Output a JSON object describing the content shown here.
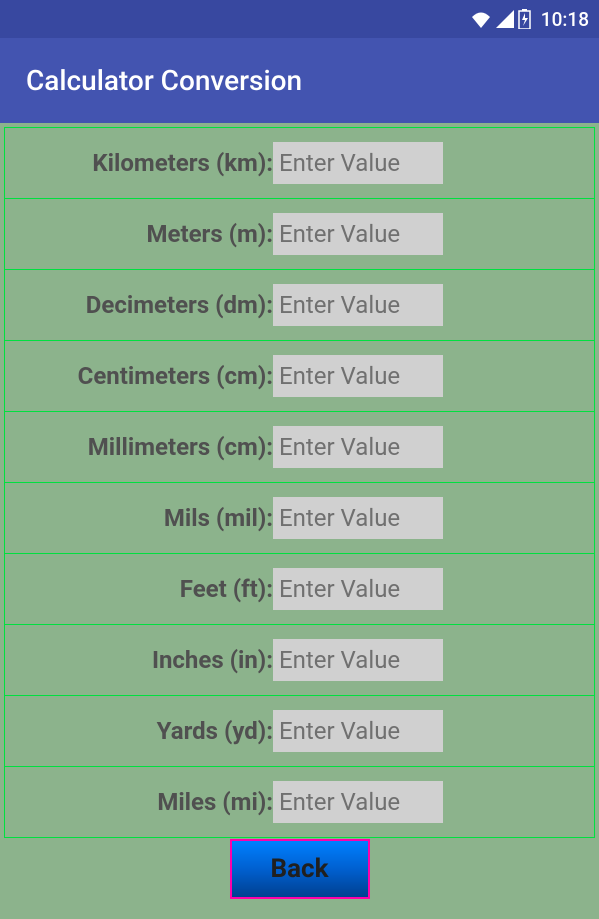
{
  "statusBar": {
    "time": "10:18"
  },
  "appBar": {
    "title": "Calculator Conversion"
  },
  "rows": [
    {
      "label": "Kilometers (km):",
      "placeholder": "Enter Value"
    },
    {
      "label": "Meters (m):",
      "placeholder": "Enter Value"
    },
    {
      "label": "Decimeters (dm):",
      "placeholder": "Enter Value"
    },
    {
      "label": "Centimeters (cm):",
      "placeholder": "Enter Value"
    },
    {
      "label": "Millimeters (cm):",
      "placeholder": "Enter Value"
    },
    {
      "label": "Mils (mil):",
      "placeholder": "Enter Value"
    },
    {
      "label": "Feet (ft):",
      "placeholder": "Enter Value"
    },
    {
      "label": "Inches (in):",
      "placeholder": "Enter Value"
    },
    {
      "label": "Yards (yd):",
      "placeholder": "Enter Value"
    },
    {
      "label": "Miles (mi):",
      "placeholder": "Enter Value"
    }
  ],
  "backButton": {
    "label": "Back"
  }
}
